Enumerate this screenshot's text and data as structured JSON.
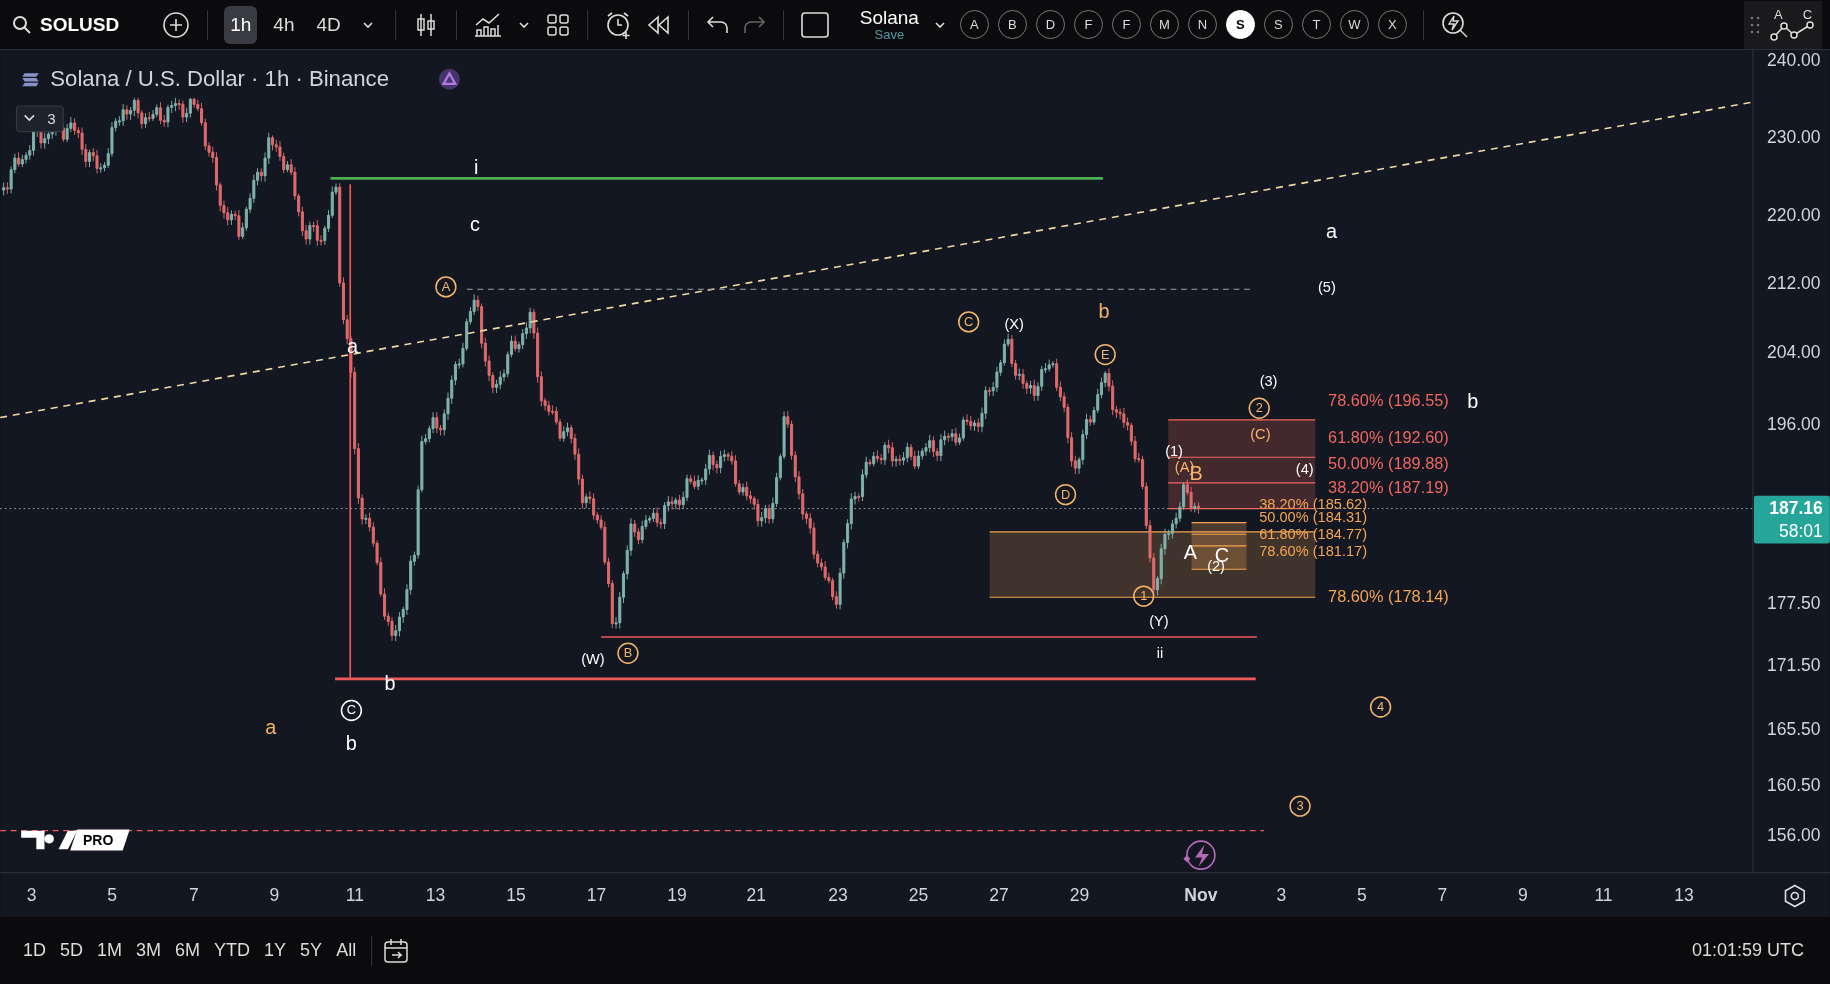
{
  "toolbar": {
    "symbol": "SOLUSD",
    "intervals": [
      {
        "label": "1h",
        "selected": true
      },
      {
        "label": "4h",
        "selected": false
      },
      {
        "label": "4D",
        "selected": false
      }
    ],
    "layout_name": "Solana",
    "save_label": "Save",
    "symbol_buttons": [
      {
        "label": "A",
        "selected": false
      },
      {
        "label": "B",
        "selected": false
      },
      {
        "label": "D",
        "selected": false
      },
      {
        "label": "F",
        "selected": false
      },
      {
        "label": "F",
        "selected": false
      },
      {
        "label": "M",
        "selected": false
      },
      {
        "label": "N",
        "selected": false
      },
      {
        "label": "S",
        "selected": true
      },
      {
        "label": "S",
        "selected": false
      },
      {
        "label": "T",
        "selected": false
      },
      {
        "label": "W",
        "selected": false
      },
      {
        "label": "X",
        "selected": false
      }
    ],
    "wave_tool_letters": [
      "A",
      "C"
    ]
  },
  "legend": {
    "title": "Solana / U.S. Dollar · 1h · Binance",
    "collapse_count": "3"
  },
  "chart": {
    "price_ticks": [
      "240.00",
      "230.00",
      "220.00",
      "212.00",
      "204.00",
      "196.00",
      "177.50",
      "171.50",
      "165.50",
      "160.50",
      "156.00"
    ],
    "date_ticks": [
      {
        "label": "3",
        "kind": "day"
      },
      {
        "label": "5",
        "kind": "day"
      },
      {
        "label": "7",
        "kind": "day"
      },
      {
        "label": "9",
        "kind": "day"
      },
      {
        "label": "11",
        "kind": "day"
      },
      {
        "label": "13",
        "kind": "day"
      },
      {
        "label": "15",
        "kind": "day"
      },
      {
        "label": "17",
        "kind": "day"
      },
      {
        "label": "19",
        "kind": "day"
      },
      {
        "label": "21",
        "kind": "day"
      },
      {
        "label": "23",
        "kind": "day"
      },
      {
        "label": "25",
        "kind": "day"
      },
      {
        "label": "27",
        "kind": "day"
      },
      {
        "label": "29",
        "kind": "day"
      },
      {
        "label": "Nov",
        "kind": "month"
      },
      {
        "label": "3",
        "kind": "day"
      },
      {
        "label": "5",
        "kind": "day"
      },
      {
        "label": "7",
        "kind": "day"
      },
      {
        "label": "9",
        "kind": "day"
      },
      {
        "label": "11",
        "kind": "day"
      },
      {
        "label": "13",
        "kind": "day"
      }
    ],
    "current_price": "187.16",
    "countdown": "58:01",
    "fib_levels": [
      {
        "text": "78.60% (196.55)",
        "color": "#f0675d"
      },
      {
        "text": "61.80% (192.60)",
        "color": "#f0675d"
      },
      {
        "text": "50.00% (189.88)",
        "color": "#f0675d"
      },
      {
        "text": "38.20% (187.19)",
        "color": "#f0675d"
      },
      {
        "text": "38.20% (185.62)",
        "color": "#f5a552"
      },
      {
        "text": "50.00% (184.31)",
        "color": "#f5a552"
      },
      {
        "text": "61.80% (184.77)",
        "color": "#f5a552"
      },
      {
        "text": "78.60% (181.17)",
        "color": "#f5a552"
      },
      {
        "text": "78.60% (178.14)",
        "color": "#f5a552"
      }
    ],
    "wave_labels": [
      {
        "text": "i",
        "kind": "plain",
        "color": "#ffffff"
      },
      {
        "text": "c",
        "kind": "plain",
        "color": "#ffffff"
      },
      {
        "text": "A",
        "kind": "circled",
        "color": "#f5b56a"
      },
      {
        "text": "a",
        "kind": "plain",
        "color": "#ffffff"
      },
      {
        "text": "b",
        "kind": "plain",
        "color": "#ffffff"
      },
      {
        "text": "C",
        "kind": "circled",
        "color": "#ffffff"
      },
      {
        "text": "b",
        "kind": "plain",
        "color": "#ffffff"
      },
      {
        "text": "a",
        "kind": "plain",
        "color": "#f5b56a"
      },
      {
        "text": "(W)",
        "kind": "plain",
        "color": "#ffffff"
      },
      {
        "text": "B",
        "kind": "circled",
        "color": "#f5b56a"
      },
      {
        "text": "C",
        "kind": "circled",
        "color": "#f5b56a"
      },
      {
        "text": "(X)",
        "kind": "plain",
        "color": "#ffffff"
      },
      {
        "text": "b",
        "kind": "plain",
        "color": "#f5b56a"
      },
      {
        "text": "E",
        "kind": "circled",
        "color": "#f5b56a"
      },
      {
        "text": "D",
        "kind": "circled",
        "color": "#f5b56a"
      },
      {
        "text": "1",
        "kind": "circled",
        "color": "#f5b56a"
      },
      {
        "text": "(Y)",
        "kind": "plain",
        "color": "#ffffff"
      },
      {
        "text": "ii",
        "kind": "plain",
        "color": "#ffffff"
      },
      {
        "text": "(1)",
        "kind": "plain",
        "color": "#ffffff"
      },
      {
        "text": "(A)",
        "kind": "plain",
        "color": "#f5b56a"
      },
      {
        "text": "B",
        "kind": "plain",
        "color": "#f5b56a"
      },
      {
        "text": "A",
        "kind": "plain",
        "color": "#ffffff"
      },
      {
        "text": "C",
        "kind": "plain",
        "color": "#ffffff"
      },
      {
        "text": "(2)",
        "kind": "plain",
        "color": "#ffffff"
      },
      {
        "text": "(3)",
        "kind": "plain",
        "color": "#ffffff"
      },
      {
        "text": "2",
        "kind": "circled",
        "color": "#f5b56a"
      },
      {
        "text": "(C)",
        "kind": "plain",
        "color": "#f5b56a"
      },
      {
        "text": "(4)",
        "kind": "plain",
        "color": "#ffffff"
      },
      {
        "text": "a",
        "kind": "plain",
        "color": "#ffffff"
      },
      {
        "text": "(5)",
        "kind": "plain",
        "color": "#ffffff"
      },
      {
        "text": "b",
        "kind": "plain",
        "color": "#ffffff"
      },
      {
        "text": "4",
        "kind": "circled",
        "color": "#f5b56a"
      },
      {
        "text": "3",
        "kind": "circled",
        "color": "#f5b56a"
      }
    ],
    "logo_badge": "PRO"
  },
  "range_buttons": [
    "1D",
    "5D",
    "1M",
    "3M",
    "6M",
    "YTD",
    "1Y",
    "5Y",
    "All"
  ],
  "clock": "01:01:59 UTC"
}
